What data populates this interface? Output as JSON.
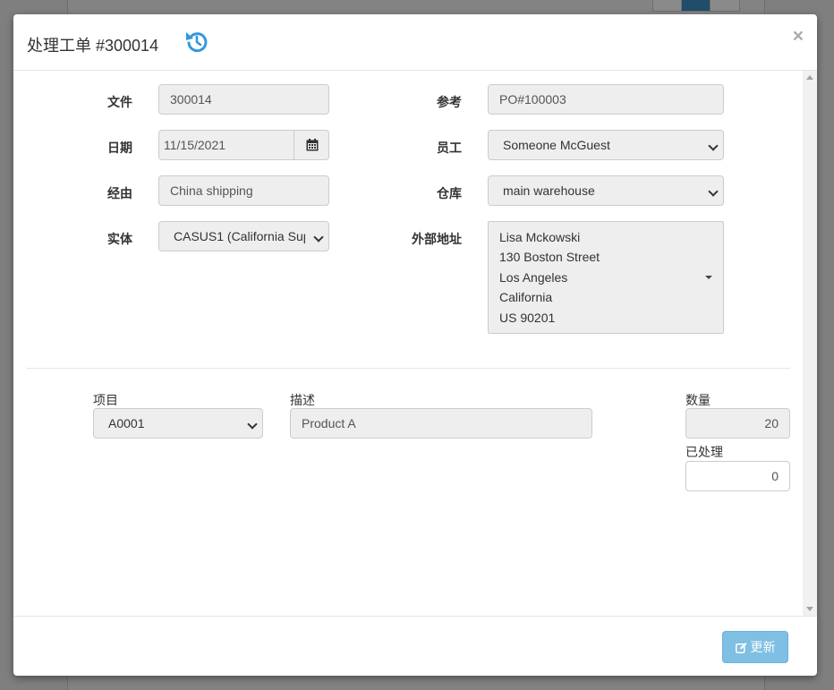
{
  "modal": {
    "title": "处理工单 #300014",
    "close_label": "×"
  },
  "form": {
    "doc_label": "文件",
    "doc_value": "300014",
    "ref_label": "参考",
    "ref_value": "PO#100003",
    "date_label": "日期",
    "date_value": "11/15/2021",
    "staff_label": "员工",
    "staff_value": "Someone McGuest",
    "via_label": "经由",
    "via_value": "China shipping",
    "warehouse_label": "仓库",
    "warehouse_value": "main warehouse",
    "entity_label": "实体",
    "entity_value": "CASUS1 (California Sup",
    "ext_addr_label": "外部地址",
    "ext_addr_lines": [
      "Lisa Mckowski",
      "130 Boston Street",
      "Los Angeles",
      "California",
      "US 90201"
    ]
  },
  "line": {
    "item_label": "项目",
    "item_value": "A0001",
    "desc_label": "描述",
    "desc_value": "Product A",
    "qty_label": "数量",
    "qty_value": "20",
    "processed_label": "已处理",
    "processed_value": "0"
  },
  "footer": {
    "update_label": "更新"
  },
  "colors": {
    "accent": "#337ab7",
    "button_bg": "#7fbfe3"
  }
}
